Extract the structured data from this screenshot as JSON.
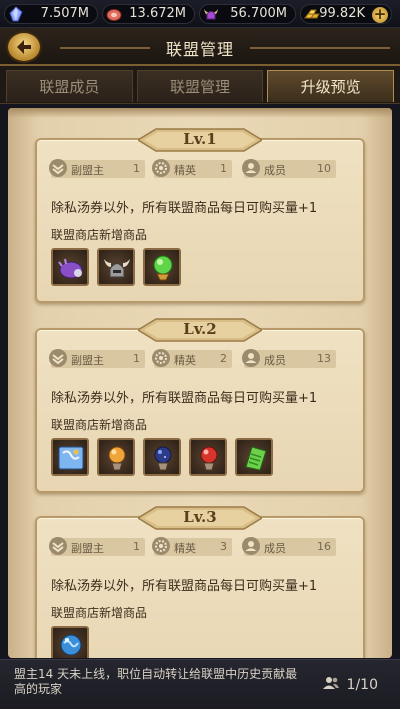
{
  "resources": [
    {
      "icon": "crystal-icon",
      "value": "7.507M"
    },
    {
      "icon": "meat-icon",
      "value": "13.672M"
    },
    {
      "icon": "horned-helmet-icon",
      "value": "56.700M"
    },
    {
      "icon": "gold-bars-icon",
      "value": "99.82K"
    }
  ],
  "header": {
    "title": "联盟管理"
  },
  "tabs": [
    {
      "label": "联盟成员",
      "active": false
    },
    {
      "label": "联盟管理",
      "active": false
    },
    {
      "label": "升级预览",
      "active": true
    }
  ],
  "levels": [
    {
      "level": "Lv.1",
      "stats": [
        {
          "label": "副盟主",
          "value": "1"
        },
        {
          "label": "精英",
          "value": "1"
        },
        {
          "label": "成员",
          "value": "10"
        }
      ],
      "benefit": "除私汤券以外，所有联盟商品每日可购买量+1",
      "shop_title": "联盟商店新增商品",
      "items": [
        "purple-beetle-icon",
        "horned-helm-icon",
        "green-orb-icon"
      ]
    },
    {
      "level": "Lv.2",
      "stats": [
        {
          "label": "副盟主",
          "value": "1"
        },
        {
          "label": "精英",
          "value": "2"
        },
        {
          "label": "成员",
          "value": "13"
        }
      ],
      "benefit": "除私汤券以外，所有联盟商品每日可购买量+1",
      "shop_title": "联盟商店新增商品",
      "items": [
        "blue-map-icon",
        "orange-orb-icon",
        "dark-blue-orb-icon",
        "red-orb-icon",
        "green-scroll-icon"
      ]
    },
    {
      "level": "Lv.3",
      "stats": [
        {
          "label": "副盟主",
          "value": "1"
        },
        {
          "label": "精英",
          "value": "3"
        },
        {
          "label": "成员",
          "value": "16"
        }
      ],
      "benefit": "除私汤券以外，所有联盟商品每日可购买量+1",
      "shop_title": "联盟商店新增商品",
      "items": [
        "globe-orb-icon"
      ]
    }
  ],
  "footer": {
    "note": "盟主14 天未上线，职位自动转让给联盟中历史贡献最高的玩家",
    "member_count": "1/10"
  }
}
